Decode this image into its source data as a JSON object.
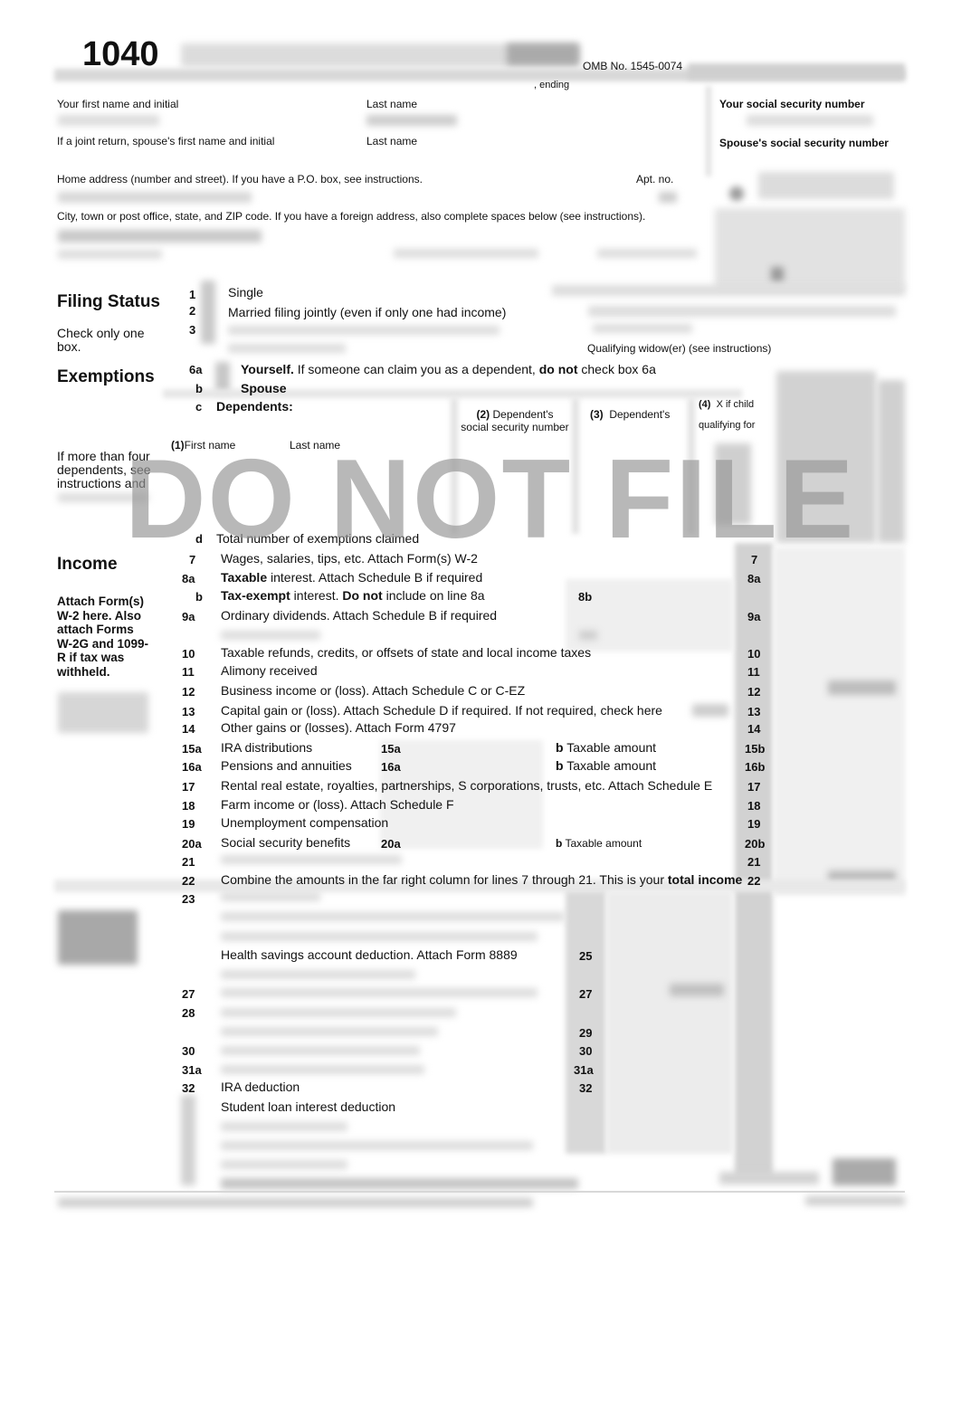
{
  "header": {
    "form_number": "1040",
    "omb": "OMB No. 1545-0074",
    "period_ending": ", ending"
  },
  "identity": {
    "first_name_label": "Your first name and initial",
    "last_name_label": "Last name",
    "ssn_label": "Your social security number",
    "spouse_first_label": "If a joint return, spouse's first name and initial",
    "spouse_last_label": "Last name",
    "spouse_ssn_label": "Spouse's social security number",
    "home_address_label": "Home address (number and street). If you have a P.O. box, see instructions.",
    "apt_label": "Apt. no.",
    "city_label": "City, town or post office, state, and ZIP code. If you have a foreign address, also complete spaces below (see instructions)."
  },
  "filing_status": {
    "title": "Filing Status",
    "note": "Check only one box.",
    "options": [
      {
        "num": "1",
        "label": "Single"
      },
      {
        "num": "2",
        "label": "Married filing jointly (even if only one had income)"
      },
      {
        "num": "3",
        "label": ""
      }
    ],
    "qualifying_widow": "Qualifying widow(er) (see instructions)"
  },
  "exemptions": {
    "title": "Exemptions",
    "line_6a_num": "6a",
    "line_6a_bold": "Yourself.",
    "line_6a_text": " If someone can claim you as a dependent, ",
    "line_6a_bold2": "do not",
    "line_6a_tail": "  check box 6a",
    "line_6b_num": "b",
    "line_6b_label": "Spouse",
    "line_6c_num": "c",
    "line_6c_label": "Dependents:",
    "col1_num": "(1)",
    "col1_first": "First name",
    "col1_last": "Last name",
    "col2_num": "(2)",
    "col2_label1": "Dependent's",
    "col2_label2": "social security number",
    "col3_num": "(3)",
    "col3_label": "Dependent's",
    "col4_num": "(4)",
    "col4_label1": "X if child",
    "col4_label2": "qualifying for",
    "side_note": "If more than four dependents, see instructions and",
    "line_d_num": "d",
    "line_d_label": "Total number of exemptions claimed"
  },
  "watermark": "DO NOT FILE",
  "income": {
    "title": "Income",
    "side_note": "Attach Form(s) W-2 here. Also attach Forms W-2G and 1099-R if tax was withheld.",
    "lines": [
      {
        "num": "7",
        "label": "Wages, salaries, tips, etc. Attach Form(s) W-2",
        "box": "7"
      },
      {
        "num": "8a",
        "bold": "Taxable",
        "label": " interest. Attach Schedule B if required",
        "box": "8a"
      },
      {
        "num": "b",
        "bold": "Tax-exempt",
        "label": " interest.  ",
        "bold2": "Do not",
        "tail": " include on line 8a",
        "mid": "8b"
      },
      {
        "num": "9a",
        "label": "Ordinary dividends. Attach Schedule B if required",
        "box": "9a"
      },
      {
        "num": "10",
        "label": "Taxable refunds, credits, or offsets of state and local income taxes",
        "box": "10"
      },
      {
        "num": "11",
        "label": "Alimony received",
        "box": "11"
      },
      {
        "num": "12",
        "label": "Business income or (loss). Attach Schedule C or C-EZ",
        "box": "12"
      },
      {
        "num": "13",
        "label": "Capital gain or (loss). Attach Schedule D if required. If not required, check here",
        "box": "13"
      },
      {
        "num": "14",
        "label": "Other gains or (losses). Attach Form 4797",
        "box": "14"
      },
      {
        "num": "15a",
        "label": "IRA distributions",
        "mid": "15a",
        "b": "b",
        "taxable": "Taxable amount",
        "box": "15b"
      },
      {
        "num": "16a",
        "label": "Pensions and annuities",
        "mid": "16a",
        "b": "b",
        "taxable": "Taxable amount",
        "box": "16b"
      },
      {
        "num": "17",
        "label": "Rental real estate, royalties, partnerships, S corporations, trusts, etc. Attach Schedule E",
        "box": "17"
      },
      {
        "num": "18",
        "label": "Farm income or (loss). Attach Schedule F",
        "box": "18"
      },
      {
        "num": "19",
        "label": "Unemployment compensation",
        "box": "19"
      },
      {
        "num": "20a",
        "label": "Social security benefits",
        "mid": "20a",
        "b": "b",
        "taxable": "Taxable amount",
        "box": "20b"
      },
      {
        "num": "21",
        "label": "",
        "box": "21"
      },
      {
        "num": "22",
        "label": "Combine the amounts in the far right column for lines 7 through 21. This is your ",
        "bold": "total income",
        "box": "22"
      }
    ]
  },
  "adjusted": {
    "lines": [
      {
        "num": "23",
        "label": ""
      },
      {
        "num": "",
        "label": "Health savings account deduction. Attach Form 8889",
        "box": "25"
      },
      {
        "num": "27",
        "label": "",
        "box": "27"
      },
      {
        "num": "28",
        "label": ""
      },
      {
        "num": "",
        "label": "",
        "box": "29"
      },
      {
        "num": "30",
        "label": "",
        "box": "30"
      },
      {
        "num": "31a",
        "label": "",
        "box": "31a"
      },
      {
        "num": "32",
        "label": "IRA deduction",
        "box": "32"
      },
      {
        "num": "",
        "label": "Student loan interest deduction"
      }
    ]
  }
}
